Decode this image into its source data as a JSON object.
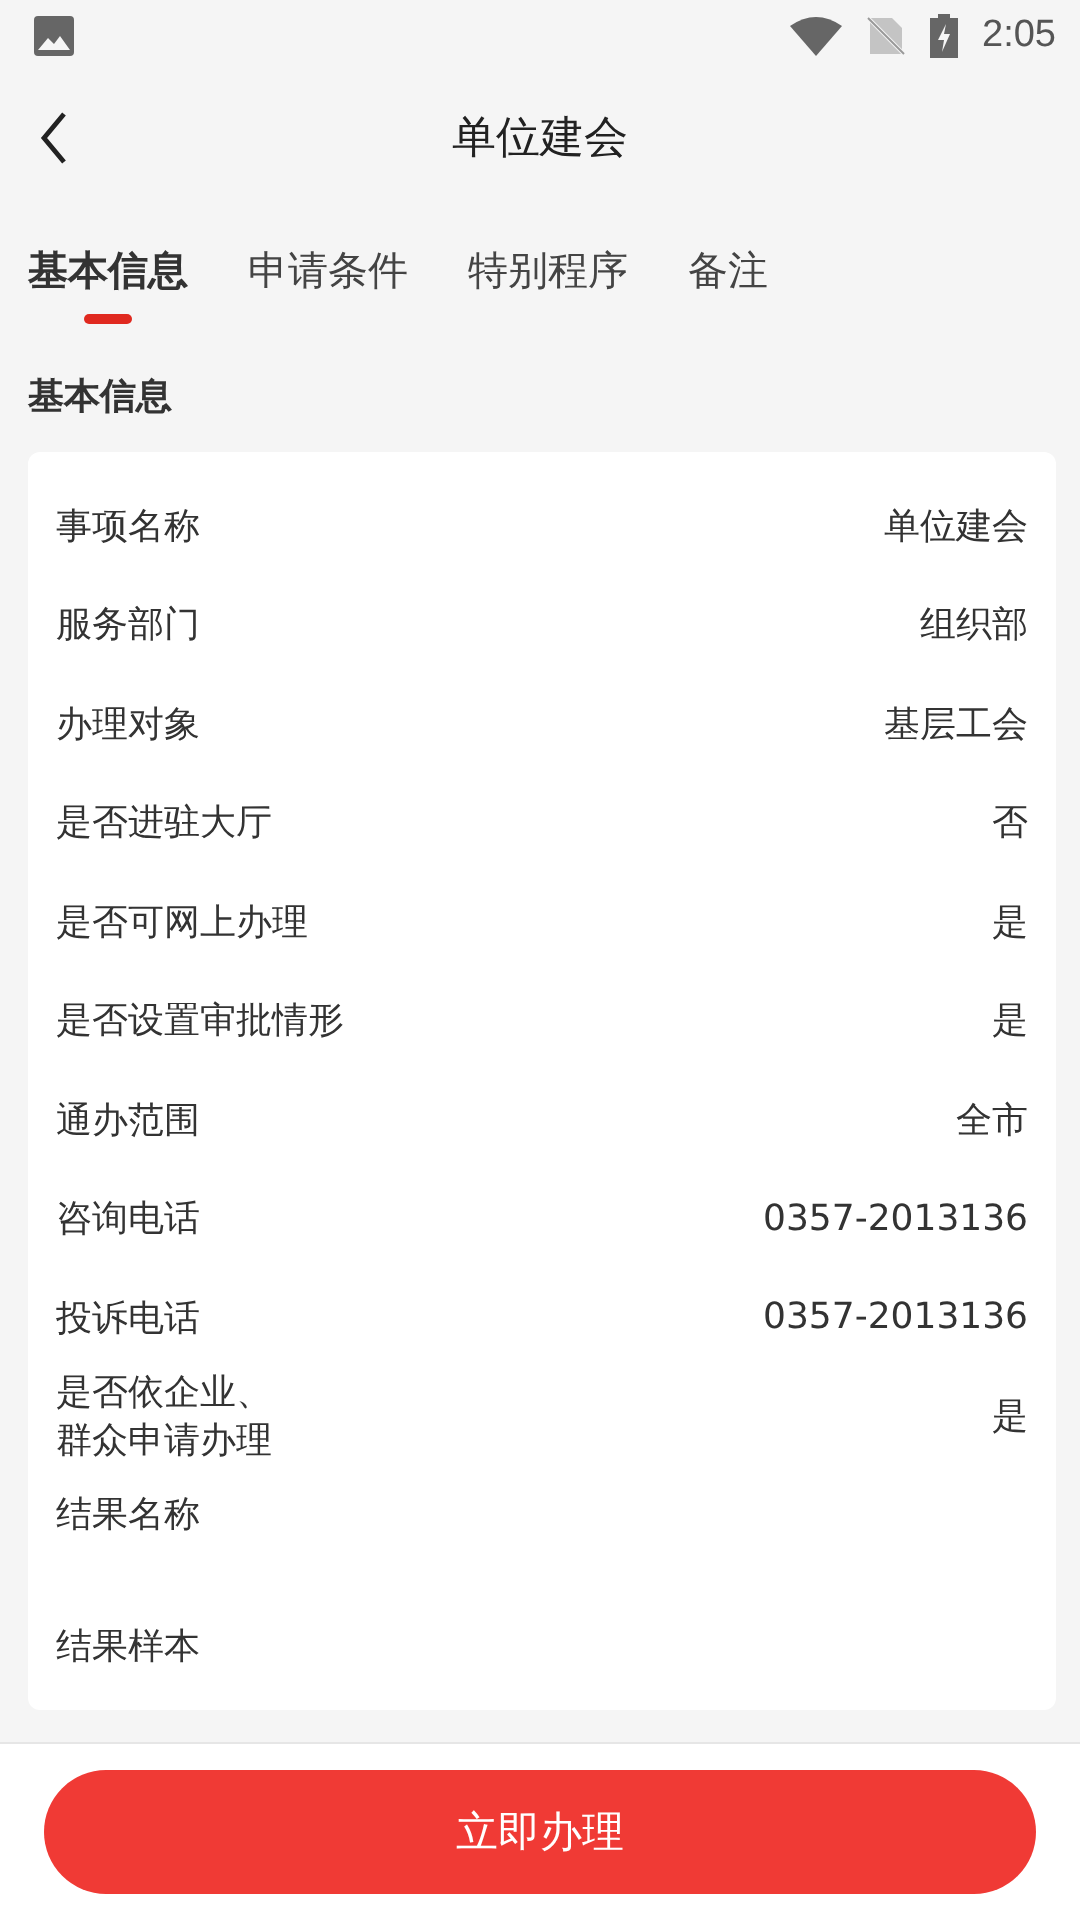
{
  "status_bar": {
    "time": "2:05"
  },
  "header": {
    "title": "单位建会"
  },
  "tabs": [
    {
      "label": "基本信息",
      "selected": true
    },
    {
      "label": "申请条件",
      "selected": false
    },
    {
      "label": "特别程序",
      "selected": false
    },
    {
      "label": "备注",
      "selected": false
    }
  ],
  "section_title": "基本信息",
  "rows": [
    {
      "label": "事项名称",
      "value": "单位建会"
    },
    {
      "label": "服务部门",
      "value": "组织部"
    },
    {
      "label": "办理对象",
      "value": "基层工会"
    },
    {
      "label": "是否进驻大厅",
      "value": "否"
    },
    {
      "label": "是否可网上办理",
      "value": "是"
    },
    {
      "label": "是否设置审批情形",
      "value": "是"
    },
    {
      "label": "通办范围",
      "value": "全市"
    },
    {
      "label": "咨询电话",
      "value": "0357-2013136"
    },
    {
      "label": "投诉电话",
      "value": "0357-2013136"
    },
    {
      "label": "是否依企业、群众申请办理",
      "value": "是"
    },
    {
      "label": "结果名称"
    },
    {
      "label": "结果样本"
    }
  ],
  "action_button": "立即办理"
}
